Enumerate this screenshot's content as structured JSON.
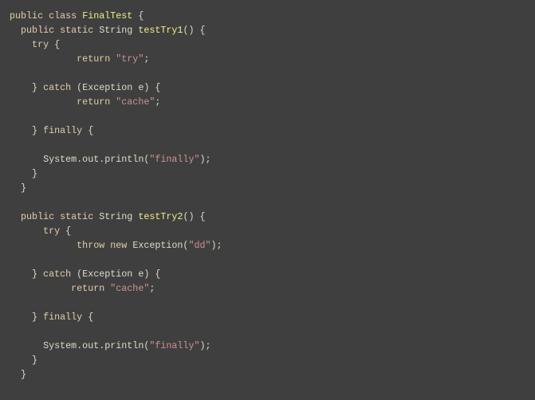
{
  "colors": {
    "background": "#3f3f3f",
    "plain": "#dcdccc",
    "keyword": "#e3ceab",
    "title": "#efef8f",
    "string": "#cc9393"
  },
  "lines": [
    {
      "tokens": [
        {
          "c": "k",
          "text": "public class "
        },
        {
          "c": "t",
          "text": "FinalTest"
        },
        {
          "c": "p",
          "text": " {"
        }
      ]
    },
    {
      "tokens": [
        {
          "c": "k",
          "text": "  public static "
        },
        {
          "c": "p",
          "text": "String "
        },
        {
          "c": "t",
          "text": "testTry1"
        },
        {
          "c": "p",
          "text": "() {"
        }
      ]
    },
    {
      "tokens": [
        {
          "c": "k",
          "text": "    try"
        },
        {
          "c": "p",
          "text": " {"
        }
      ]
    },
    {
      "tokens": [
        {
          "c": "k",
          "text": "            return "
        },
        {
          "c": "s",
          "text": "\"try\""
        },
        {
          "c": "p",
          "text": ";"
        }
      ]
    },
    {
      "tokens": []
    },
    {
      "tokens": [
        {
          "c": "p",
          "text": "    } "
        },
        {
          "c": "k",
          "text": "catch"
        },
        {
          "c": "p",
          "text": " (Exception e) {"
        }
      ]
    },
    {
      "tokens": [
        {
          "c": "k",
          "text": "            return "
        },
        {
          "c": "s",
          "text": "\"cache\""
        },
        {
          "c": "p",
          "text": ";"
        }
      ]
    },
    {
      "tokens": []
    },
    {
      "tokens": [
        {
          "c": "p",
          "text": "    } "
        },
        {
          "c": "k",
          "text": "finally"
        },
        {
          "c": "p",
          "text": " {"
        }
      ]
    },
    {
      "tokens": []
    },
    {
      "tokens": [
        {
          "c": "p",
          "text": "      System.out.println("
        },
        {
          "c": "s",
          "text": "\"finally\""
        },
        {
          "c": "p",
          "text": ");"
        }
      ]
    },
    {
      "tokens": [
        {
          "c": "p",
          "text": "    }"
        }
      ]
    },
    {
      "tokens": [
        {
          "c": "p",
          "text": "  }"
        }
      ]
    },
    {
      "tokens": []
    },
    {
      "tokens": [
        {
          "c": "k",
          "text": "  public static "
        },
        {
          "c": "p",
          "text": "String "
        },
        {
          "c": "t",
          "text": "testTry2"
        },
        {
          "c": "p",
          "text": "() {"
        }
      ]
    },
    {
      "tokens": [
        {
          "c": "k",
          "text": "      try"
        },
        {
          "c": "p",
          "text": " {"
        }
      ]
    },
    {
      "tokens": [
        {
          "c": "k",
          "text": "            throw new "
        },
        {
          "c": "p",
          "text": "Exception("
        },
        {
          "c": "s",
          "text": "\"dd\""
        },
        {
          "c": "p",
          "text": ");"
        }
      ]
    },
    {
      "tokens": []
    },
    {
      "tokens": [
        {
          "c": "p",
          "text": "    } "
        },
        {
          "c": "k",
          "text": "catch"
        },
        {
          "c": "p",
          "text": " (Exception e) {"
        }
      ]
    },
    {
      "tokens": [
        {
          "c": "k",
          "text": "           return "
        },
        {
          "c": "s",
          "text": "\"cache\""
        },
        {
          "c": "p",
          "text": ";"
        }
      ]
    },
    {
      "tokens": []
    },
    {
      "tokens": [
        {
          "c": "p",
          "text": "    } "
        },
        {
          "c": "k",
          "text": "finally"
        },
        {
          "c": "p",
          "text": " {"
        }
      ]
    },
    {
      "tokens": []
    },
    {
      "tokens": [
        {
          "c": "p",
          "text": "      System.out.println("
        },
        {
          "c": "s",
          "text": "\"finally\""
        },
        {
          "c": "p",
          "text": ");"
        }
      ]
    },
    {
      "tokens": [
        {
          "c": "p",
          "text": "    }"
        }
      ]
    },
    {
      "tokens": [
        {
          "c": "p",
          "text": "  }"
        }
      ]
    }
  ]
}
